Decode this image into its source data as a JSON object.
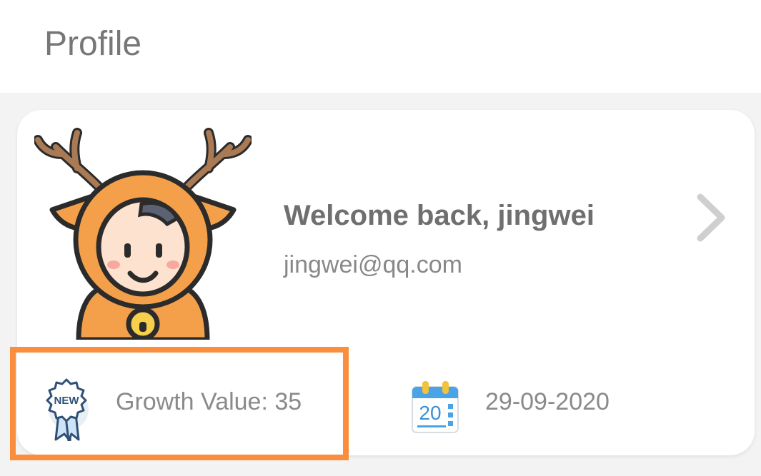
{
  "header": {
    "title": "Profile"
  },
  "profile": {
    "welcome": "Welcome back, jingwei",
    "email": "jingwei@qq.com",
    "badge_text": "NEW",
    "growth_value": "Growth Value: 35",
    "calendar_day": "20",
    "date": "29-09-2020"
  },
  "colors": {
    "highlight": "#fb8e3c",
    "avatar_orange": "#f4a04a",
    "antler_brown": "#a97a54"
  },
  "icons": [
    "deer-avatar",
    "chevron-right-icon",
    "new-badge-icon",
    "calendar-icon"
  ]
}
